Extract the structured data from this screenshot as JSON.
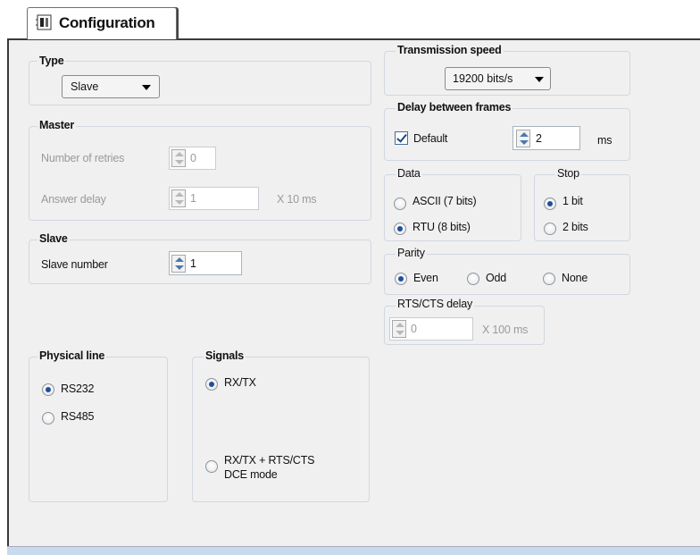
{
  "tab": {
    "label": "Configuration"
  },
  "type": {
    "title": "Type",
    "selected": "Slave"
  },
  "master": {
    "title": "Master",
    "retries_label": "Number of retries",
    "retries_value": "0",
    "answer_delay_label": "Answer delay",
    "answer_delay_value": "1",
    "answer_delay_unit": "X 10 ms"
  },
  "slave": {
    "title": "Slave",
    "number_label": "Slave number",
    "number_value": "1"
  },
  "physical_line": {
    "title": "Physical line",
    "options": [
      {
        "label": "RS232",
        "selected": true
      },
      {
        "label": "RS485",
        "selected": false
      }
    ]
  },
  "signals": {
    "title": "Signals",
    "opt1": "RX/TX",
    "opt2_line1": "RX/TX + RTS/CTS",
    "opt2_line2": "DCE mode",
    "selected": "RX/TX"
  },
  "transmission_speed": {
    "title": "Transmission speed",
    "selected": "19200 bits/s"
  },
  "delay_frames": {
    "title": "Delay between frames",
    "default_label": "Default",
    "default_checked": true,
    "value": "2",
    "unit": "ms"
  },
  "data": {
    "title": "Data",
    "opt1": "ASCII (7 bits)",
    "opt2": "RTU (8 bits)",
    "selected": "RTU (8 bits)"
  },
  "stop": {
    "title": "Stop",
    "opt1": "1 bit",
    "opt2": "2 bits",
    "selected": "1 bit"
  },
  "parity": {
    "title": "Parity",
    "opt1": "Even",
    "opt2": "Odd",
    "opt3": "None",
    "selected": "Even"
  },
  "rts_cts": {
    "title": "RTS/CTS delay",
    "value": "0",
    "unit": "X 100 ms"
  },
  "colors": {
    "panel_bg": "#f0f0f0",
    "group_border": "#d2d8df",
    "radio_dot": "#1f4f9c",
    "disabled_text": "#9a9a9a"
  }
}
